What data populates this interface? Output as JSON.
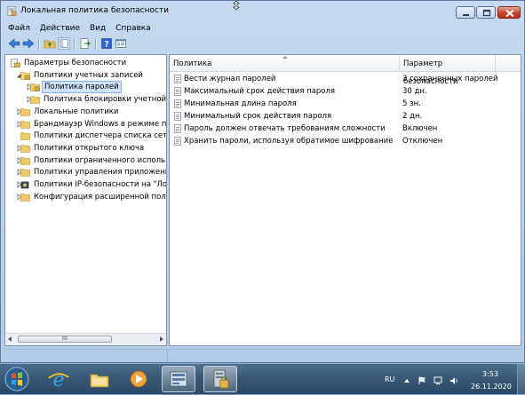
{
  "window": {
    "title": "Локальная политика безопасности"
  },
  "menu": [
    "Файл",
    "Действие",
    "Вид",
    "Справка"
  ],
  "tree": [
    {
      "label": "Параметры безопасности",
      "level": 0,
      "expander": "none",
      "icon": "security-settings-icon"
    },
    {
      "label": "Политики учетных записей",
      "level": 1,
      "expander": "expanded",
      "icon": "folder-open-icon"
    },
    {
      "label": "Политика паролей",
      "level": 2,
      "expander": "collapsed",
      "icon": "folder-icon",
      "selected": true
    },
    {
      "label": "Политика блокировки учетной з",
      "level": 2,
      "expander": "collapsed",
      "icon": "folder-icon"
    },
    {
      "label": "Локальные политики",
      "level": 1,
      "expander": "collapsed",
      "icon": "folder-icon"
    },
    {
      "label": "Брандмауэр Windows в режиме пов",
      "level": 1,
      "expander": "collapsed",
      "icon": "folder-icon"
    },
    {
      "label": "Политики диспетчера списка сетей",
      "level": 1,
      "expander": "none",
      "icon": "folder-icon"
    },
    {
      "label": "Политики открытого ключа",
      "level": 1,
      "expander": "collapsed",
      "icon": "folder-icon"
    },
    {
      "label": "Политики ограниченного использо",
      "level": 1,
      "expander": "collapsed",
      "icon": "folder-icon"
    },
    {
      "label": "Политики управления приложения",
      "level": 1,
      "expander": "collapsed",
      "icon": "folder-icon"
    },
    {
      "label": "Политики IP-безопасности на \"Лока",
      "level": 1,
      "expander": "collapsed",
      "icon": "ipsec-icon"
    },
    {
      "label": "Конфигурация расширенной полит",
      "level": 1,
      "expander": "collapsed",
      "icon": "folder-icon"
    }
  ],
  "scrollbar_thumb_glyph": "III",
  "list": {
    "columns": [
      "Политика",
      "Параметр безопасности"
    ],
    "rows": [
      {
        "policy": "Вести журнал паролей",
        "value": "3 сохраненных паролей"
      },
      {
        "policy": "Максимальный срок действия пароля",
        "value": "30 дн."
      },
      {
        "policy": "Минимальная длина пароля",
        "value": "5 зн."
      },
      {
        "policy": "Минимальный срок действия пароля",
        "value": "2 дн."
      },
      {
        "policy": "Пароль должен отвечать требованиям сложности",
        "value": "Включен"
      },
      {
        "policy": "Хранить пароли, используя обратимое шифрование",
        "value": "Отключен"
      }
    ]
  },
  "taskbar": {
    "language": "RU",
    "time": "3:53",
    "date": "26.11.2020",
    "apps": [
      "ie-icon",
      "explorer-icon",
      "media-player-icon",
      "server-manager-icon",
      "local-security-policy-icon"
    ]
  },
  "colors": {
    "selection": "#cfe3fb",
    "close_button": "#c6452d",
    "taskbar": "#3b5a78"
  }
}
